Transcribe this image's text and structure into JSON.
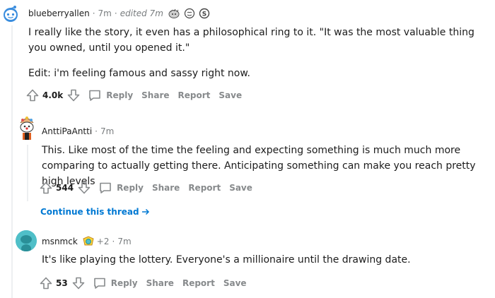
{
  "comments": [
    {
      "username": "blueberryallen",
      "time": "7m",
      "edited": "edited 7m",
      "paragraphs": [
        "I really like the story, it even has a philosophical ring to it. \"It was the most valuable thing you owned, until you opened it.\"",
        "Edit: i'm feeling famous and sassy right now."
      ],
      "votes": "4.0k",
      "avatar_icon": "snoo-avatar-icon"
    },
    {
      "username": "AnttiPaAntti",
      "time": "7m",
      "paragraphs": [
        "This. Like most of the time the feeling and expecting something is much much more comparing to actually getting there. Anticipating something can make you reach pretty high levels"
      ],
      "votes": "544",
      "avatar_icon": "clown-snoo-avatar-icon"
    },
    {
      "username": "msnmck",
      "award_count": "+2",
      "time": "7m",
      "paragraphs": [
        "It's like playing the lottery. Everyone's a millionaire until the drawing date."
      ],
      "votes": "53",
      "avatar_icon": "teal-snoo-avatar-icon"
    }
  ],
  "actions": {
    "reply": "Reply",
    "share": "Share",
    "report": "Report",
    "save": "Save"
  },
  "continue_thread": "Continue this thread",
  "colors": {
    "link": "#0079d3",
    "muted": "#878a8c",
    "thread_line": "#edeff1",
    "avatar_blue": "#0dd3bb",
    "avatar_teal": "#4fbfc8"
  }
}
